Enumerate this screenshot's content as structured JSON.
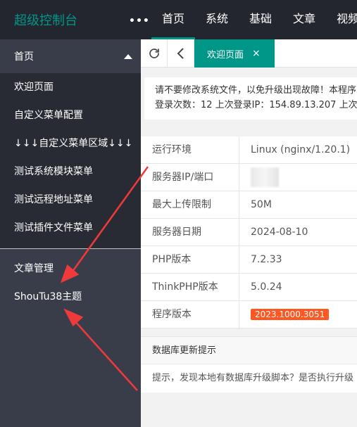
{
  "header": {
    "logo": "超级控制台",
    "more": "•••",
    "nav": [
      "首页",
      "系统",
      "基础",
      "文章",
      "视频"
    ]
  },
  "sidebar": {
    "group_title": "首页",
    "sub_items": [
      "欢迎页面",
      "自定义菜单配置",
      "↓↓↓自定义菜单区域↓↓↓",
      "测试系统模块菜单",
      "测试远程地址菜单",
      "测试插件文件菜单"
    ],
    "main_items": [
      "文章管理",
      "ShouTu38主题"
    ]
  },
  "tabs": {
    "active_label": "欢迎页面",
    "close": "×"
  },
  "notice": {
    "line1": "请不要修改系统文件，以免升级出现故障！本程序",
    "line2": "登录次数：12 上次登录IP：154.89.13.207 上次登"
  },
  "info": {
    "rows": [
      {
        "key": "运行环境",
        "value": "Linux (nginx/1.20.1)"
      },
      {
        "key": "服务器IP/端口",
        "value": ""
      },
      {
        "key": "最大上传限制",
        "value": "50M"
      },
      {
        "key": "服务器日期",
        "value": "2024-08-10"
      },
      {
        "key": "PHP版本",
        "value": "7.2.33"
      },
      {
        "key": "ThinkPHP版本",
        "value": "5.0.24"
      },
      {
        "key": "程序版本",
        "value": "2023.1000.3051"
      }
    ]
  },
  "db_panel": {
    "title": "数据库更新提示",
    "body": "提示，发现本地有数据库升级脚本？是否执行升级"
  },
  "colors": {
    "topbar": "#23262e",
    "sidebar": "#393d49",
    "accent": "#009688",
    "badge": "#ff5722",
    "arrow": "#f0393a"
  },
  "icons": [
    "refresh-icon",
    "back-icon",
    "close-icon",
    "caret-up-icon"
  ]
}
